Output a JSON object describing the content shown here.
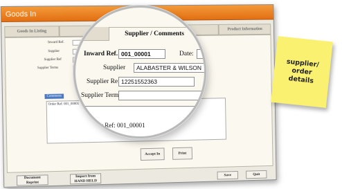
{
  "window": {
    "title": "Goods In"
  },
  "tabs": [
    {
      "label": "Goods In Listing"
    },
    {
      "label": ""
    },
    {
      "label": "Supplier / Comments"
    },
    {
      "label": ""
    },
    {
      "label": "Product Information"
    }
  ],
  "form": {
    "inward_ref_label": "Inward Ref.",
    "inward_ref_value": "001_00001",
    "date_label": "Date:",
    "supplier_label": "Supplier",
    "supplier_value": "ALABASTER & WILSON",
    "supplier_ref_label": "Supplier Ref",
    "supplier_ref_value": "12251552363",
    "supplier_terms_label": "Supplier Terms",
    "supplier_terms_value": "",
    "comments_label": "Comments",
    "comments_value": "Order Ref: 001_00001"
  },
  "buttons": {
    "accept_in": "Accept In",
    "print": "Print",
    "document_reprint": "Document\nReprint",
    "import_hand_held": "Import from\nHAND HELD",
    "save": "Save",
    "quit": "Quit"
  },
  "note": {
    "text": "supplier/\norder\ndetails",
    "color": "#fbf170"
  },
  "colors": {
    "title_bar": "#e8771a",
    "comments_label_bg": "#4a78c2"
  }
}
